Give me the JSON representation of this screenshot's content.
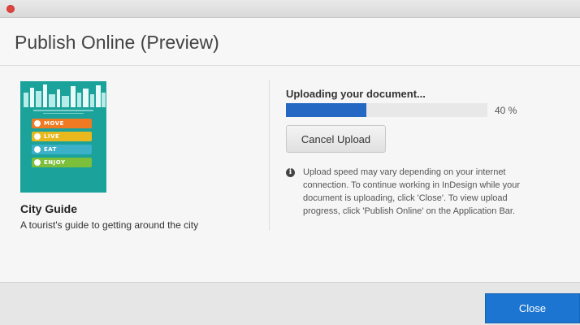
{
  "window": {
    "title": "Publish Online (Preview)"
  },
  "document": {
    "cover": {
      "items": [
        {
          "label": "MOVE",
          "color": "#f07a22"
        },
        {
          "label": "LIVE",
          "color": "#e8b81c"
        },
        {
          "label": "EAT",
          "color": "#3bb0c8"
        },
        {
          "label": "ENJOY",
          "color": "#7cbf3a"
        }
      ],
      "background": "#1aa29b"
    },
    "title": "City Guide",
    "description": "A tourist's guide to getting around the city"
  },
  "upload": {
    "status": "Uploading your document...",
    "progress_value": 0.4,
    "progress_label": "40 %",
    "cancel_label": "Cancel Upload",
    "info_icon": "info-icon",
    "info_text": "Upload speed may vary depending on your internet connection. To continue working in InDesign while your document is uploading, click 'Close'. To view upload progress, click 'Publish Online' on the Application Bar."
  },
  "footer": {
    "close_label": "Close"
  },
  "colors": {
    "accent": "#1c75d0",
    "progress": "#2468c4",
    "window_close": "#e0443e"
  }
}
